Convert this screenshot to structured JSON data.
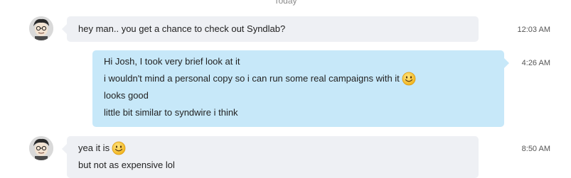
{
  "day_divider": "Today",
  "messages": [
    {
      "direction": "incoming",
      "time": "12:03 AM",
      "lines": [
        "hey man.. you get a chance to check out Syndlab?"
      ]
    },
    {
      "direction": "outgoing",
      "time": "4:26 AM",
      "lines": [
        "Hi Josh, I took very brief look at it",
        "i wouldn't mind a personal copy so i can run some real campaigns with it",
        "looks good",
        "little bit similar to syndwire i think"
      ]
    },
    {
      "direction": "incoming",
      "time": "8:50 AM",
      "lines": [
        "yea it is",
        "but not as expensive lol"
      ]
    }
  ],
  "icons": {
    "emoji": "smiley-emoji-icon",
    "avatar": "contact-avatar"
  },
  "colors": {
    "incoming_bubble": "#eef0f4",
    "outgoing_bubble": "#c7e8f9",
    "emoji": "#f6c02c"
  }
}
